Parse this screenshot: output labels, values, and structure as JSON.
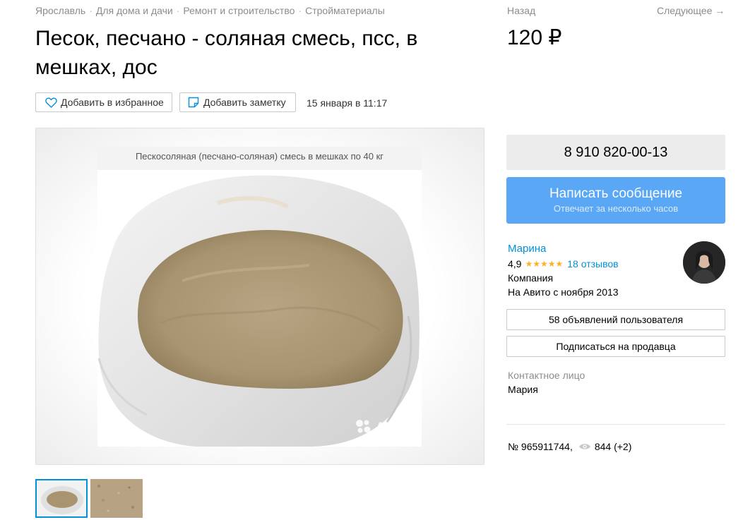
{
  "breadcrumbs": [
    "Ярославль",
    "Для дома и дачи",
    "Ремонт и строительство",
    "Стройматериалы"
  ],
  "title": "Песок, песчано - соляная смесь, псс, в мешках, дос",
  "nav": {
    "back": "Назад",
    "next": "Следующее →"
  },
  "price": "120 ₽",
  "actions": {
    "favorite": "Добавить в избранное",
    "note": "Добавить заметку",
    "date": "15 января в 11:17"
  },
  "gallery": {
    "caption": "Пескосоляная (песчано-соляная) смесь в мешках по 40 кг",
    "watermark": "Avito"
  },
  "phone": "8 910 820-00-13",
  "message_button": {
    "label": "Написать сообщение",
    "sub": "Отвечает за несколько часов"
  },
  "seller": {
    "name": "Марина",
    "rating": "4,9",
    "stars": "★★★★★",
    "reviews": "18 отзывов",
    "type": "Компания",
    "since": "На Авито с ноября 2013"
  },
  "seller_buttons": {
    "ads": "58 объявлений пользователя",
    "subscribe": "Подписаться на продавца"
  },
  "contact": {
    "label": "Контактное лицо",
    "name": "Мария"
  },
  "meta": {
    "id": "№ 965911744,",
    "views": "844 (+2)"
  },
  "colors": {
    "link": "#0091d9",
    "message_button": "#59a7f5",
    "stars": "#ffb021"
  }
}
